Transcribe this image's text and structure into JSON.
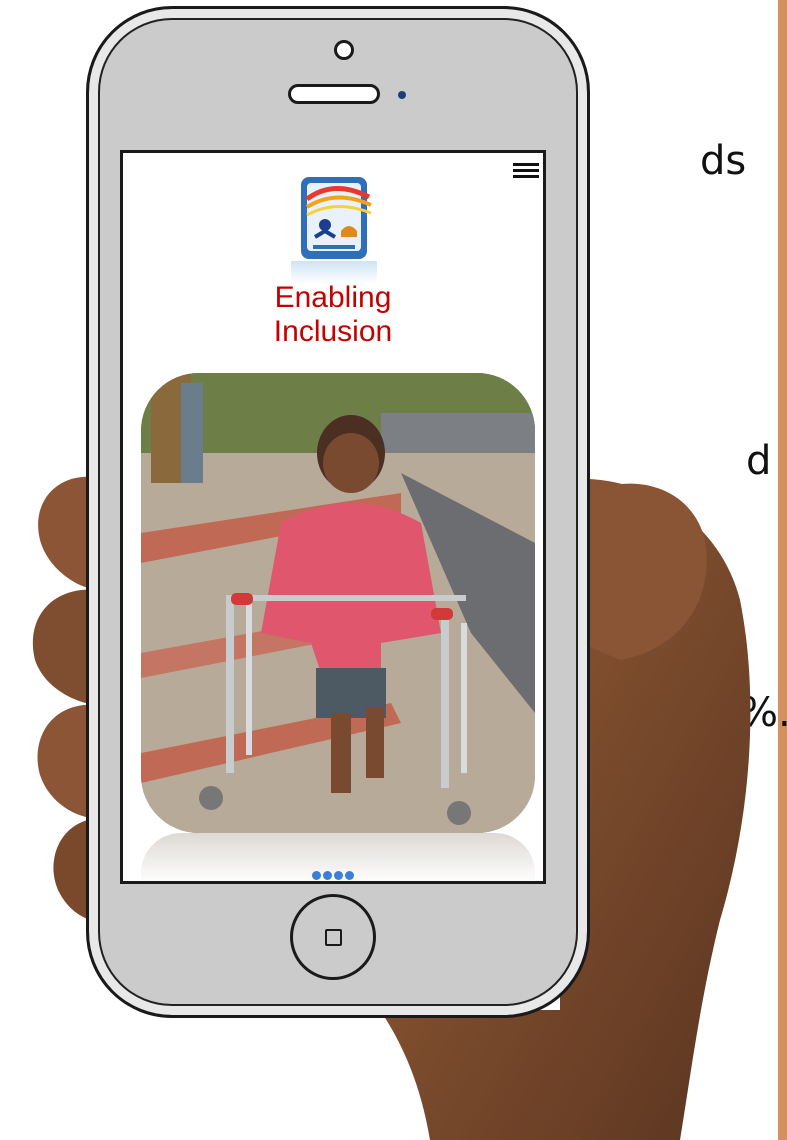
{
  "slide_text": {
    "line1": "ds",
    "line2": "d",
    "line3": "%."
  },
  "app": {
    "title_line1": "Enabling",
    "title_line2": "Inclusion"
  },
  "carousel": {
    "pages": 4,
    "active_index": 0
  },
  "icons": {
    "menu": "hamburger-menu-icon",
    "home": "home-square-icon"
  },
  "colors": {
    "title": "#c40000",
    "carousel_dot": "#3b7fd6",
    "phone_body": "#cbcbcb",
    "slide_accent_stripe": "#d4915f"
  }
}
